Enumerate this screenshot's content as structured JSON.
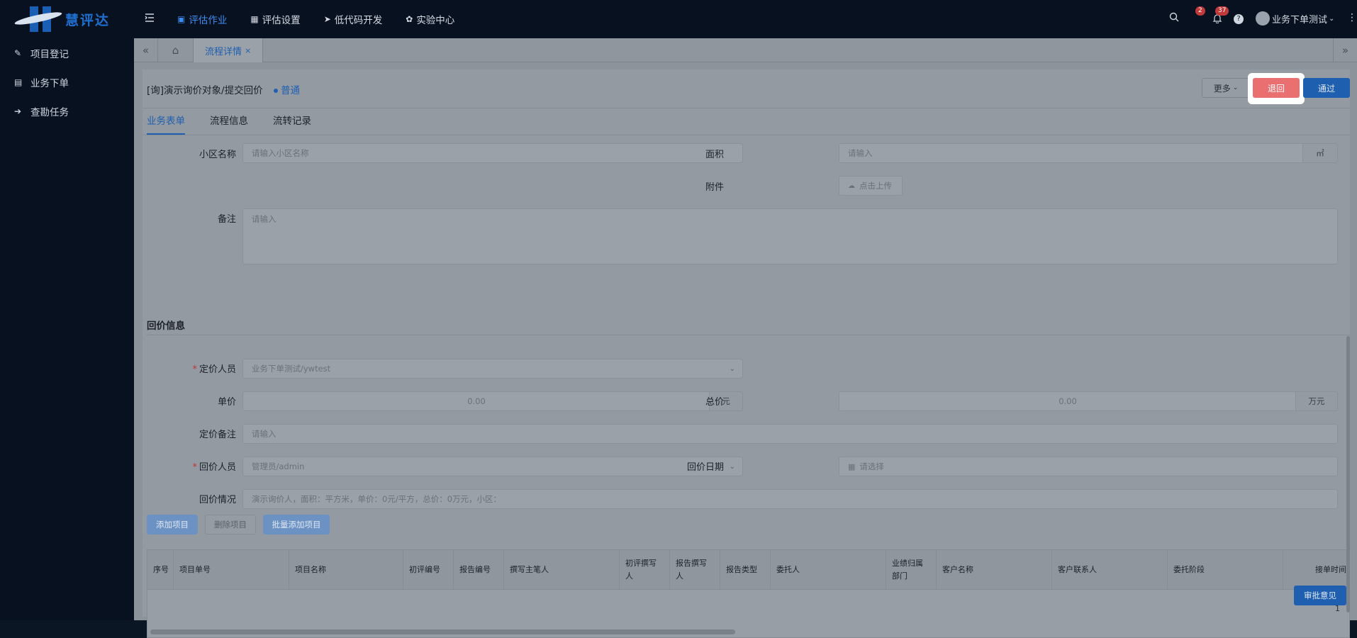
{
  "app": {
    "name": "慧评达"
  },
  "nav": [
    {
      "label": "评估作业",
      "icon": "archive-icon",
      "active": true
    },
    {
      "label": "评估设置",
      "icon": "grid-icon",
      "active": false
    },
    {
      "label": "低代码开发",
      "icon": "rocket-icon",
      "active": false
    },
    {
      "label": "实验中心",
      "icon": "clover-icon",
      "active": false
    }
  ],
  "tools": {
    "notice_badge": "2",
    "bell_badge": "37",
    "user_name": "业务下单测试"
  },
  "sidebar": [
    {
      "label": "项目登记",
      "icon": "edit-icon"
    },
    {
      "label": "业务下单",
      "icon": "calendar-icon"
    },
    {
      "label": "查勘任务",
      "icon": "walk-icon"
    }
  ],
  "tabs": {
    "active_label": "流程详情"
  },
  "page": {
    "title": "[询]演示询价对象/提交回价",
    "level": "普通",
    "more_label": "更多",
    "reject_label": "退回",
    "pass_label": "通过"
  },
  "subtabs": [
    "业务表单",
    "流程信息",
    "流转记录"
  ],
  "form": {
    "community": {
      "label": "小区名称",
      "placeholder": "请输入小区名称"
    },
    "area": {
      "label": "面积",
      "placeholder": "请输入",
      "unit": "㎡"
    },
    "attachment": {
      "label": "附件",
      "button": "点击上传"
    },
    "remark": {
      "label": "备注",
      "placeholder": "请输入"
    }
  },
  "section": {
    "title": "回价信息"
  },
  "quote": {
    "pricer": {
      "label": "定价人员",
      "value": "业务下单测试/ywtest"
    },
    "unit_price": {
      "label": "单价",
      "value": "0.00",
      "unit": "元"
    },
    "total_price": {
      "label": "总价",
      "value": "0.00",
      "unit": "万元"
    },
    "price_remark": {
      "label": "定价备注",
      "placeholder": "请输入"
    },
    "replier": {
      "label": "回价人员",
      "value": "管理员/admin"
    },
    "reply_date": {
      "label": "回价日期",
      "placeholder": "请选择"
    },
    "reply_status": {
      "label": "回价情况",
      "value": "演示询价人，面积：平方米，单价：0元/平方，总价：0万元，小区："
    }
  },
  "table_buttons": {
    "add": "添加项目",
    "delete": "删除项目",
    "batch_add": "批量添加项目"
  },
  "table": {
    "columns": [
      "序号",
      "项目单号",
      "项目名称",
      "初评编号",
      "报告编号",
      "撰写主笔人",
      "初评撰写人",
      "报告撰写人",
      "报告类型",
      "委托人",
      "业绩归属部门",
      "客户名称",
      "客户联系人",
      "委托阶段",
      "接单时间"
    ],
    "page": "1"
  },
  "review_label": "审批意见"
}
